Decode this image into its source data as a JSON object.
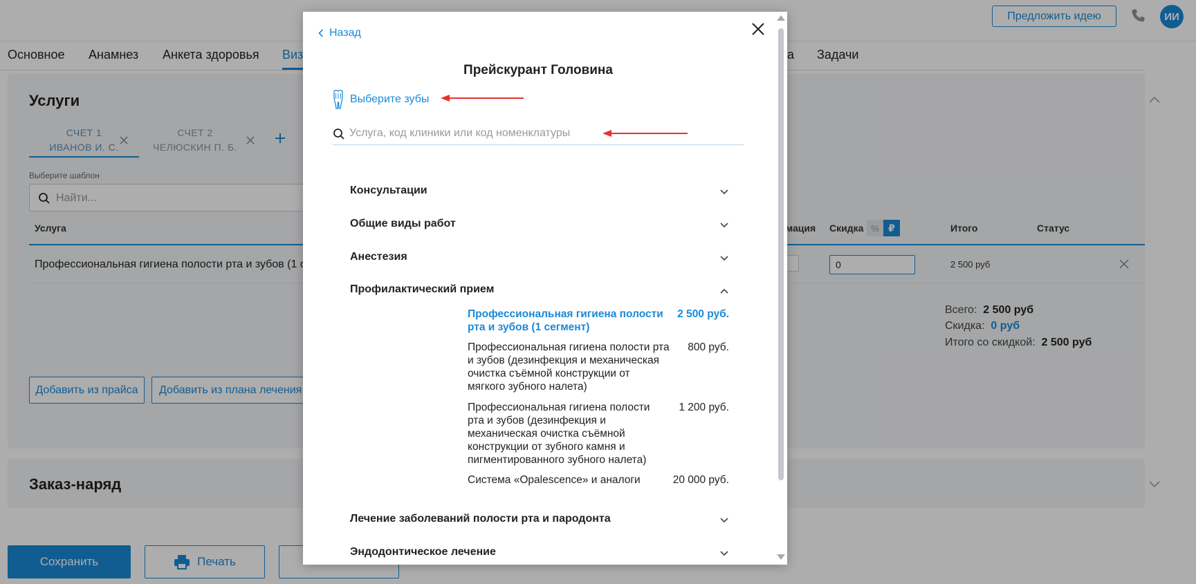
{
  "header": {
    "idea_button": "Предложить идею",
    "avatar_initials": "ИИ",
    "accent_color": "#1a8ad8"
  },
  "tabs": [
    {
      "label": "Основное"
    },
    {
      "label": "Анамнез"
    },
    {
      "label": "Анкета здоровья"
    },
    {
      "label": "Виз"
    },
    {
      "label": "а"
    },
    {
      "label": "Задачи"
    }
  ],
  "services_card": {
    "title": "Услуги",
    "accounts": [
      {
        "label": "СЧЕТ 1",
        "person": "ИВАНОВ И. С."
      },
      {
        "label": "СЧЕТ 2",
        "person": "ЧЕЛЮСКИН П. Б."
      }
    ],
    "template_label": "Выберите шаблон",
    "template_placeholder": "Найти...",
    "columns": {
      "service": "Услуга",
      "formulation": "амация",
      "discount": "Скидка",
      "percent": "%",
      "ruble": "₽",
      "total": "Итого",
      "status": "Статус"
    },
    "row": {
      "service": "Профессиональная гигиена полости рта и зубов (1 се",
      "discount": "0",
      "total": "2 500 руб"
    },
    "totals": {
      "all_label": "Всего:",
      "all_value": "2 500 руб",
      "discount_label": "Скидка:",
      "discount_value": "0 руб",
      "final_label": "Итого со скидкой:",
      "final_value": "2 500 руб"
    },
    "add_from_price": "Добавить из прайса",
    "add_from_plan": "Добавить из плана лечения"
  },
  "order_card": {
    "title": "Заказ-наряд"
  },
  "footer": {
    "save": "Сохранить",
    "print": "Печать"
  },
  "modal": {
    "back": "Назад",
    "title": "Прейскурант Головина",
    "choose_teeth": "Выберите зубы",
    "search_placeholder": "Услуга, код клиники или код номенклатуры",
    "categories": [
      {
        "label": "Консультации"
      },
      {
        "label": "Общие виды работ"
      },
      {
        "label": "Анестезия"
      },
      {
        "label": "Профилактический прием"
      },
      {
        "label": "Лечение заболеваний полости рта и пародонта"
      },
      {
        "label": "Эндодонтическое лечение"
      }
    ],
    "services": [
      {
        "name": "Профессиональная гигиена полости\nрта и зубов (1 сегмент)",
        "price": "2 500 руб."
      },
      {
        "name": "Профессиональная гигиена полости рта\nи зубов (дезинфекция и механическая\nочистка съёмной конструкции от\nмягкого зубного налета)",
        "price": "800 руб."
      },
      {
        "name": "Профессиональная гигиена полости\nрта и зубов (дезинфекция и\nмеханическая очистка съёмной\nконструкции от зубного камня и\nпигментированного зубного налета)",
        "price": "1 200 руб."
      },
      {
        "name": "Система «Opalescence» и аналоги",
        "price": "20 000 руб."
      }
    ]
  }
}
